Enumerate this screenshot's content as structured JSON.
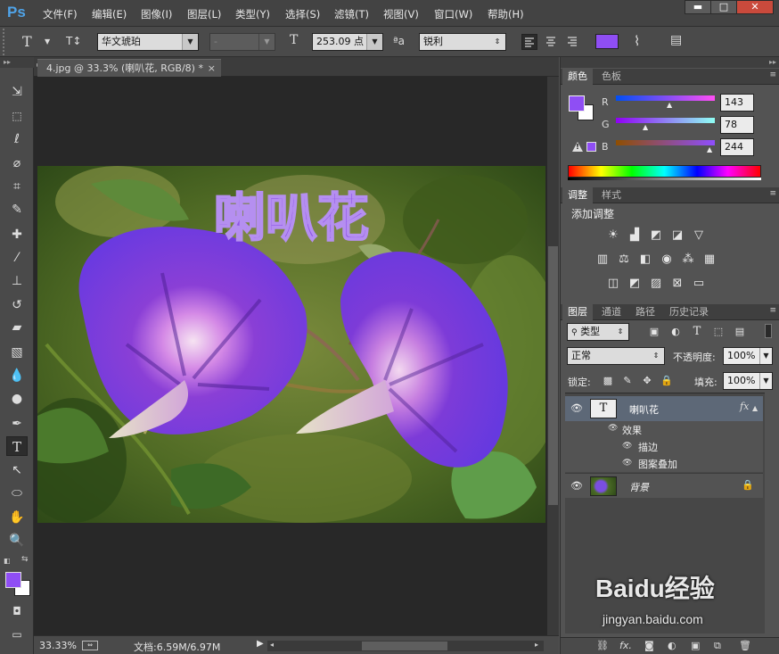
{
  "menubar": {
    "logo": "Ps",
    "items": [
      "文件(F)",
      "编辑(E)",
      "图像(I)",
      "图层(L)",
      "类型(Y)",
      "选择(S)",
      "滤镜(T)",
      "视图(V)",
      "窗口(W)",
      "帮助(H)"
    ],
    "window_buttons": [
      "▬",
      "□",
      "✕"
    ]
  },
  "options": {
    "tool_icon": "T",
    "orientation_icon": "T↕",
    "font_family": "华文琥珀",
    "font_style": "-",
    "size_icon": "T",
    "font_size": "253.09 点",
    "aa_icon": "ªa",
    "antialias": "锐利",
    "text_color": "#8f4ef4"
  },
  "document": {
    "tab_title": "4.jpg @ 33.3% (喇叭花, RGB/8) *",
    "tab_close": "×",
    "canvas_text": "喇叭花",
    "zoom": "33.33%",
    "doc_info": "文档:6.59M/6.97M"
  },
  "color_panel": {
    "tabs": [
      "颜色",
      "色板"
    ],
    "r_label": "R",
    "g_label": "G",
    "b_label": "B",
    "r_value": "143",
    "g_value": "78",
    "b_value": "244",
    "foreground": "#8f4ef4",
    "warning_icon": "!"
  },
  "adjust_panel": {
    "tabs": [
      "调整",
      "样式"
    ],
    "title": "添加调整"
  },
  "layers_panel": {
    "tabs": [
      "图层",
      "通道",
      "路径",
      "历史记录"
    ],
    "filter_type": "类型",
    "blend_mode": "正常",
    "opacity_label": "不透明度:",
    "opacity_value": "100%",
    "lock_label": "锁定:",
    "fill_label": "填充:",
    "fill_value": "100%",
    "layers": [
      {
        "name": "喇叭花",
        "thumb": "T",
        "fx": "fx"
      },
      {
        "name": "背景"
      }
    ],
    "effects_label": "效果",
    "effects": [
      "描边",
      "图案叠加"
    ],
    "bottom_icons": [
      "⛓",
      "fx.",
      "◙",
      "◐",
      "▣",
      "⧉",
      "🗑"
    ]
  },
  "watermark": {
    "brand": "Baidu经验",
    "url": "jingyan.baidu.com"
  }
}
